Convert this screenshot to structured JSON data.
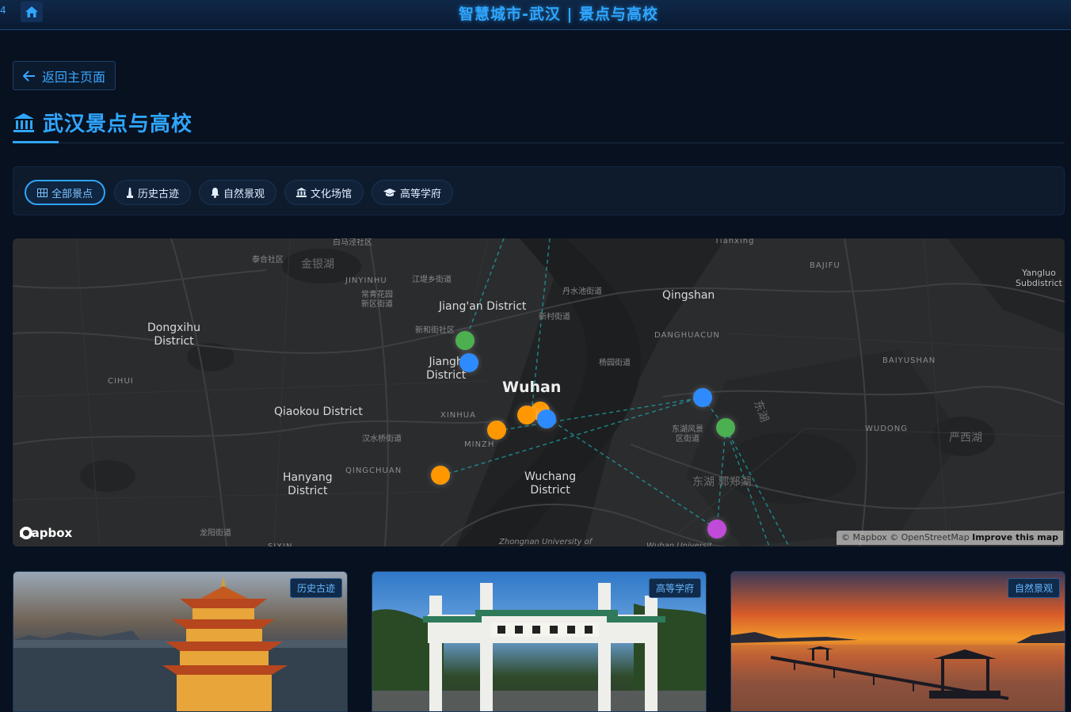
{
  "topbar": {
    "left_tag": "4",
    "title": "智慧城市-武汉 | 景点与高校"
  },
  "back_button": {
    "label": "返回主页面"
  },
  "page": {
    "title": "武汉景点与高校"
  },
  "filters": [
    {
      "label": "全部景点",
      "icon": "grid-icon",
      "active": true
    },
    {
      "label": "历史古迹",
      "icon": "monument-icon",
      "active": false
    },
    {
      "label": "自然景观",
      "icon": "bell-icon",
      "active": false
    },
    {
      "label": "文化场馆",
      "icon": "museum-icon",
      "active": false
    },
    {
      "label": "高等学府",
      "icon": "graduation-cap-icon",
      "active": false
    }
  ],
  "map": {
    "labels": {
      "dongxihu": "Dongxihu\nDistrict",
      "jiangan": "Jiang'an District",
      "jianghan": "Jiangh\nDistrict",
      "wuhan": "Wuhan",
      "qingshan": "Qingshan",
      "qiaokou": "Qiaokou District",
      "hanyang": "Hanyang\nDistrict",
      "wuchang": "Wuchang\nDistrict",
      "yangluo": "Yangluo\nSubdistrict",
      "jinyinhu": "JINYINHU",
      "cihui": "CIHUI",
      "xinhua": "XINHUA",
      "minzhu": "MINZH",
      "qingchuan": "QINGCHUAN",
      "danghuacun": "DANGHUACUN",
      "baiyushan": "BAIYUSHAN",
      "wudong": "WUDONG",
      "bajifu": "BAJIFU",
      "tianxing": "Tianxing",
      "jinyinhu_cn": "金银湖",
      "donghu_cn": "东湖 郭郑湖",
      "yanxi_cn": "严西湖",
      "donghu_vert_cn": "东湖",
      "jiangdi_cn": "江堤乡街道",
      "changqing_cn": "常青花园\n新区街道",
      "xinhe_cn": "新和街社区",
      "danshui_cn": "丹水池街道",
      "xincun_cn": "新村街道",
      "yangyuan_cn": "杨园街道",
      "hanzheng_cn": "汉水桥街道",
      "donghu_feng_cn": "东湖风景\n区街道",
      "longyang_cn": "龙阳街道",
      "taihe_cn": "泰合社区",
      "baiquan_cn": "白马泾社区",
      "sixin": "SIXIN",
      "zhongnan": "Zhongnan University of",
      "wuhan_univ": "Wuhan Universit"
    },
    "markers": [
      {
        "name": "green",
        "color": "#4caf50"
      },
      {
        "name": "blue",
        "color": "#2d8bff"
      },
      {
        "name": "orange",
        "color": "#ff9800"
      },
      {
        "name": "purple",
        "color": "#c04bd8"
      }
    ],
    "logo": "mapbox",
    "attribution": "© Mapbox © OpenStreetMap",
    "improve": "Improve this map"
  },
  "cards": [
    {
      "badge": "历史古迹"
    },
    {
      "badge": "高等学府"
    },
    {
      "badge": "自然景观"
    }
  ],
  "colors": {
    "accent": "#2fa6ff",
    "background": "#08111f"
  }
}
